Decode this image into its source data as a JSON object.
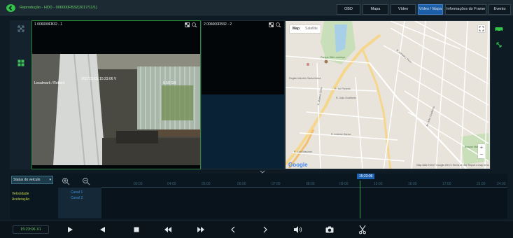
{
  "header": {
    "title": "Reprodução - HDD - 006000FB32(2017/11/1)",
    "tabs": [
      {
        "label": "OBD",
        "active": false
      },
      {
        "label": "Mapa",
        "active": false
      },
      {
        "label": "Vídeo",
        "active": false
      },
      {
        "label": "Vídeo / Mapa",
        "active": true
      },
      {
        "label": "Informações do Frame",
        "active": false
      },
      {
        "label": "Evento",
        "active": false
      }
    ]
  },
  "video": {
    "pane1_label": "1 006000FB32 - 1",
    "pane2_label": "2 006000FB32 - 2",
    "osd_left": "Localmark / Reboot",
    "osd_center": "2017/11/01 15:23:06 V",
    "osd_right": "6.50 GB"
  },
  "map": {
    "type_map": "Map",
    "type_satellite": "Satellite",
    "zoom_in": "+",
    "zoom_out": "−",
    "google": "Google",
    "footer": "Map data ©2017 Google   200 m   Terms of Use   Report a map error",
    "streets": [
      "Parque São Lourenço",
      "Região Marcílio Santa Maria",
      "R. Mateus Leme",
      "R. Ivo Ricardo",
      "R. João Gualberto",
      "R. Antônio Garcia",
      "R. Luiz Manzoni",
      "Av. João Gualberto",
      "R. Amadeu Alves",
      "Bosque Marten"
    ]
  },
  "timeline": {
    "status_label": "Status do veículo",
    "current_time": "15:23:06",
    "ticks": [
      "03:00",
      "04:00",
      "05:00",
      "06:00",
      "07:00",
      "08:00",
      "09:00",
      "10:00",
      "11:00",
      "12:00",
      "13:00",
      "14:00",
      "15:00",
      "16:00",
      "17:00",
      "18:00",
      "19:00",
      "20:00",
      "21:00",
      "22:00",
      "23:00",
      "24:00"
    ],
    "rows": [
      "Velocidade",
      "Aceleração"
    ],
    "channels": [
      "Canal 1",
      "Canal 2"
    ]
  },
  "controls": {
    "clock": "15:23:06   X1"
  },
  "colors": {
    "accent_green": "#33c24a",
    "active_tab": "#1d5ea8",
    "timeline_blue": "#3f8ed8"
  }
}
